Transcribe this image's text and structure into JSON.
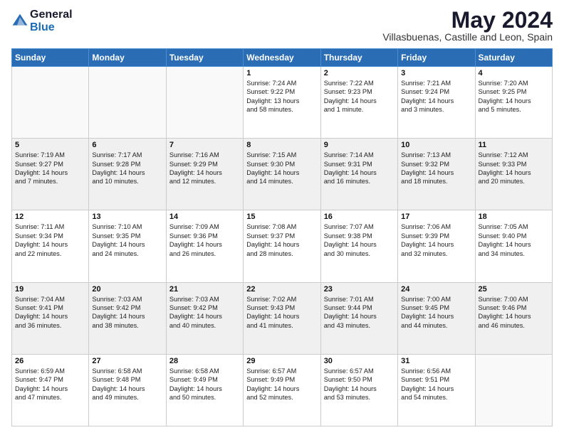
{
  "header": {
    "logo_general": "General",
    "logo_blue": "Blue",
    "month_title": "May 2024",
    "location": "Villasbuenas, Castille and Leon, Spain"
  },
  "weekdays": [
    "Sunday",
    "Monday",
    "Tuesday",
    "Wednesday",
    "Thursday",
    "Friday",
    "Saturday"
  ],
  "weeks": [
    [
      {
        "day": "",
        "content": ""
      },
      {
        "day": "",
        "content": ""
      },
      {
        "day": "",
        "content": ""
      },
      {
        "day": "1",
        "content": "Sunrise: 7:24 AM\nSunset: 9:22 PM\nDaylight: 13 hours\nand 58 minutes."
      },
      {
        "day": "2",
        "content": "Sunrise: 7:22 AM\nSunset: 9:23 PM\nDaylight: 14 hours\nand 1 minute."
      },
      {
        "day": "3",
        "content": "Sunrise: 7:21 AM\nSunset: 9:24 PM\nDaylight: 14 hours\nand 3 minutes."
      },
      {
        "day": "4",
        "content": "Sunrise: 7:20 AM\nSunset: 9:25 PM\nDaylight: 14 hours\nand 5 minutes."
      }
    ],
    [
      {
        "day": "5",
        "content": "Sunrise: 7:19 AM\nSunset: 9:27 PM\nDaylight: 14 hours\nand 7 minutes."
      },
      {
        "day": "6",
        "content": "Sunrise: 7:17 AM\nSunset: 9:28 PM\nDaylight: 14 hours\nand 10 minutes."
      },
      {
        "day": "7",
        "content": "Sunrise: 7:16 AM\nSunset: 9:29 PM\nDaylight: 14 hours\nand 12 minutes."
      },
      {
        "day": "8",
        "content": "Sunrise: 7:15 AM\nSunset: 9:30 PM\nDaylight: 14 hours\nand 14 minutes."
      },
      {
        "day": "9",
        "content": "Sunrise: 7:14 AM\nSunset: 9:31 PM\nDaylight: 14 hours\nand 16 minutes."
      },
      {
        "day": "10",
        "content": "Sunrise: 7:13 AM\nSunset: 9:32 PM\nDaylight: 14 hours\nand 18 minutes."
      },
      {
        "day": "11",
        "content": "Sunrise: 7:12 AM\nSunset: 9:33 PM\nDaylight: 14 hours\nand 20 minutes."
      }
    ],
    [
      {
        "day": "12",
        "content": "Sunrise: 7:11 AM\nSunset: 9:34 PM\nDaylight: 14 hours\nand 22 minutes."
      },
      {
        "day": "13",
        "content": "Sunrise: 7:10 AM\nSunset: 9:35 PM\nDaylight: 14 hours\nand 24 minutes."
      },
      {
        "day": "14",
        "content": "Sunrise: 7:09 AM\nSunset: 9:36 PM\nDaylight: 14 hours\nand 26 minutes."
      },
      {
        "day": "15",
        "content": "Sunrise: 7:08 AM\nSunset: 9:37 PM\nDaylight: 14 hours\nand 28 minutes."
      },
      {
        "day": "16",
        "content": "Sunrise: 7:07 AM\nSunset: 9:38 PM\nDaylight: 14 hours\nand 30 minutes."
      },
      {
        "day": "17",
        "content": "Sunrise: 7:06 AM\nSunset: 9:39 PM\nDaylight: 14 hours\nand 32 minutes."
      },
      {
        "day": "18",
        "content": "Sunrise: 7:05 AM\nSunset: 9:40 PM\nDaylight: 14 hours\nand 34 minutes."
      }
    ],
    [
      {
        "day": "19",
        "content": "Sunrise: 7:04 AM\nSunset: 9:41 PM\nDaylight: 14 hours\nand 36 minutes."
      },
      {
        "day": "20",
        "content": "Sunrise: 7:03 AM\nSunset: 9:42 PM\nDaylight: 14 hours\nand 38 minutes."
      },
      {
        "day": "21",
        "content": "Sunrise: 7:03 AM\nSunset: 9:42 PM\nDaylight: 14 hours\nand 40 minutes."
      },
      {
        "day": "22",
        "content": "Sunrise: 7:02 AM\nSunset: 9:43 PM\nDaylight: 14 hours\nand 41 minutes."
      },
      {
        "day": "23",
        "content": "Sunrise: 7:01 AM\nSunset: 9:44 PM\nDaylight: 14 hours\nand 43 minutes."
      },
      {
        "day": "24",
        "content": "Sunrise: 7:00 AM\nSunset: 9:45 PM\nDaylight: 14 hours\nand 44 minutes."
      },
      {
        "day": "25",
        "content": "Sunrise: 7:00 AM\nSunset: 9:46 PM\nDaylight: 14 hours\nand 46 minutes."
      }
    ],
    [
      {
        "day": "26",
        "content": "Sunrise: 6:59 AM\nSunset: 9:47 PM\nDaylight: 14 hours\nand 47 minutes."
      },
      {
        "day": "27",
        "content": "Sunrise: 6:58 AM\nSunset: 9:48 PM\nDaylight: 14 hours\nand 49 minutes."
      },
      {
        "day": "28",
        "content": "Sunrise: 6:58 AM\nSunset: 9:49 PM\nDaylight: 14 hours\nand 50 minutes."
      },
      {
        "day": "29",
        "content": "Sunrise: 6:57 AM\nSunset: 9:49 PM\nDaylight: 14 hours\nand 52 minutes."
      },
      {
        "day": "30",
        "content": "Sunrise: 6:57 AM\nSunset: 9:50 PM\nDaylight: 14 hours\nand 53 minutes."
      },
      {
        "day": "31",
        "content": "Sunrise: 6:56 AM\nSunset: 9:51 PM\nDaylight: 14 hours\nand 54 minutes."
      },
      {
        "day": "",
        "content": ""
      }
    ]
  ]
}
